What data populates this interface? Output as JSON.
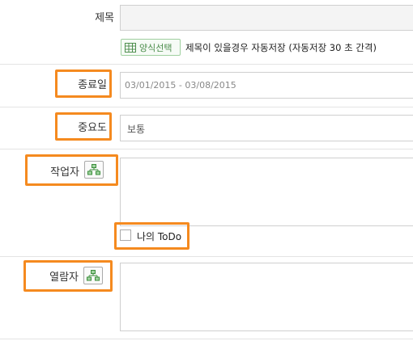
{
  "form": {
    "title_label": "제목",
    "title_value": "",
    "template_button_label": "양식선택",
    "autosave_note": "제목이 있을경우 자동저장 (자동저장 30 초 간격)",
    "end_date_label": "종료일",
    "end_date_value": "03/01/2015 - 03/08/2015",
    "priority_label": "중요도",
    "priority_value": "보통",
    "assignee_label": "작업자",
    "my_todo_label": "나의 ToDo",
    "viewer_label": "열람자"
  },
  "colors": {
    "highlight": "#f58a1f",
    "template_button": "#4c8e4c"
  }
}
